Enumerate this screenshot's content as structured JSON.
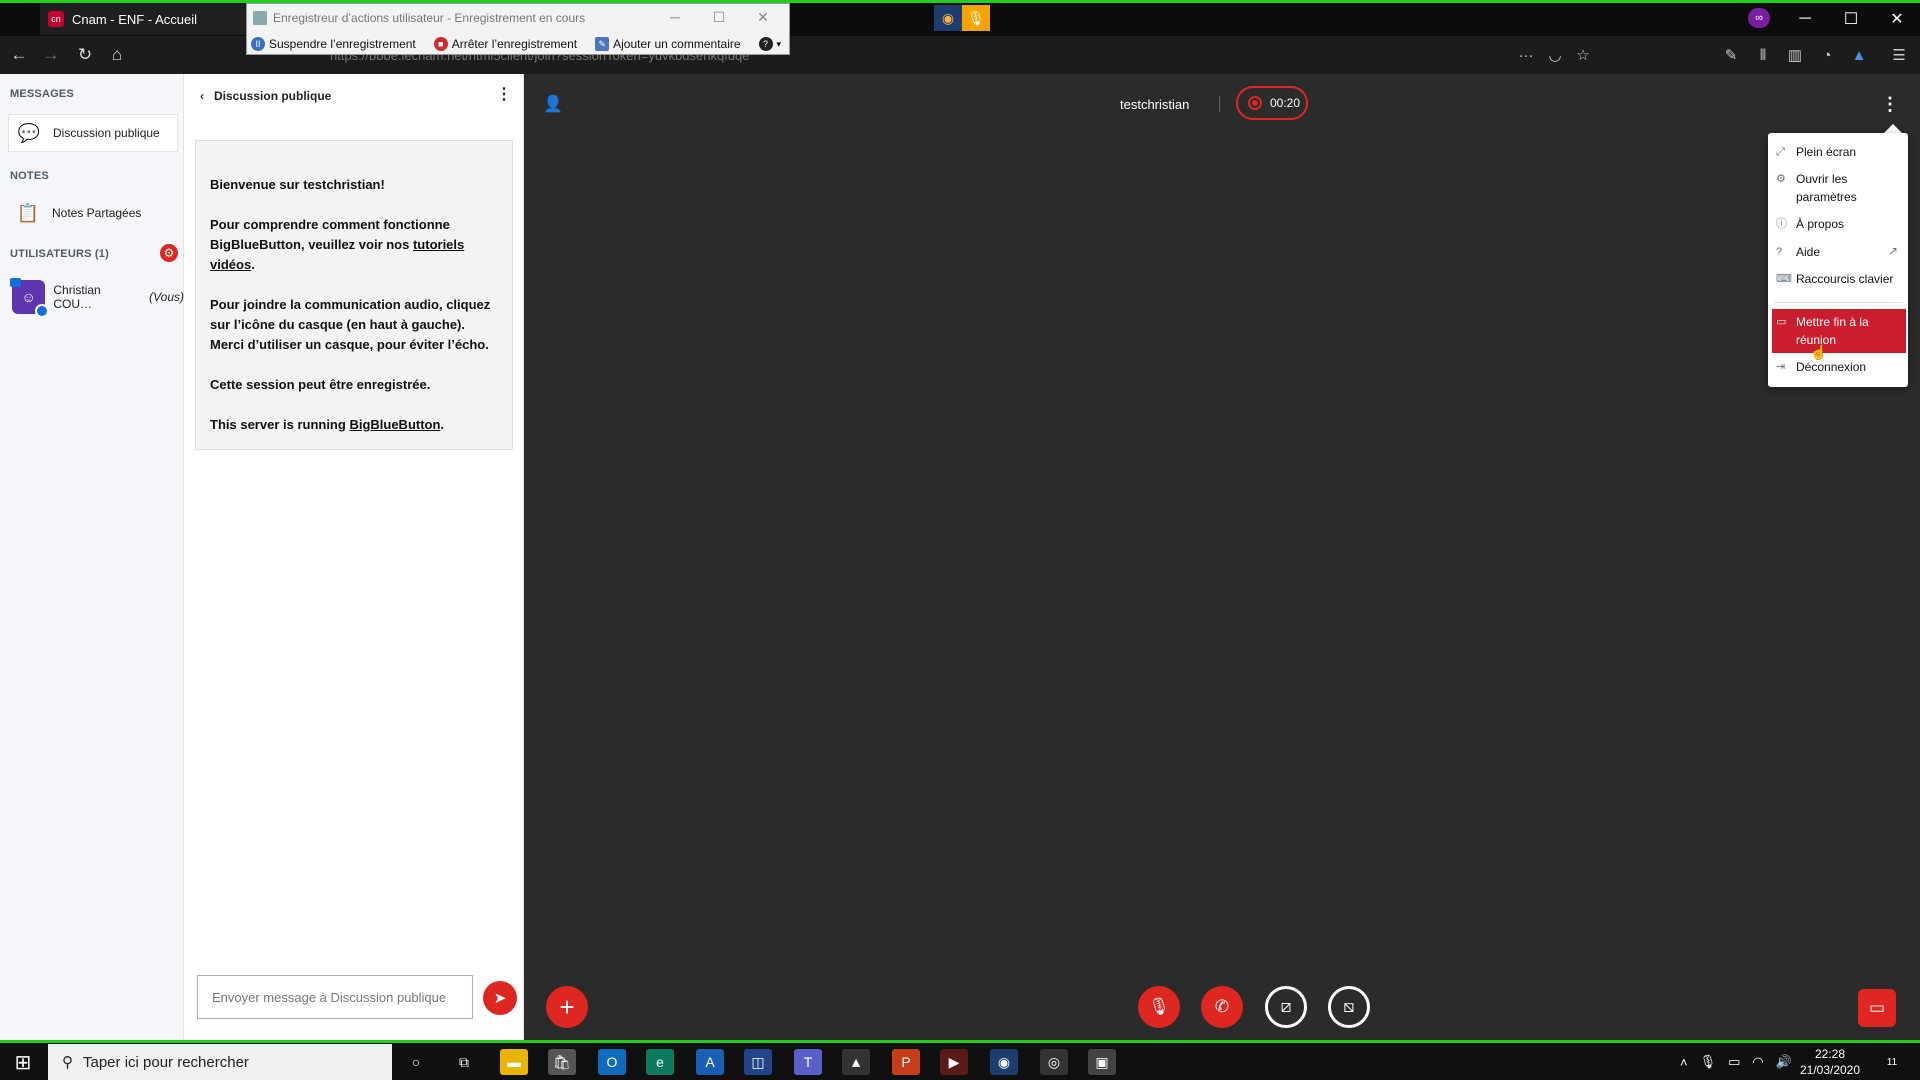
{
  "browser": {
    "tab_title": "Cnam - ENF - Accueil",
    "url": "https://bbbe.lecnam.net/html5client/join?sessionToken=yuvkbdsenkqfuqe"
  },
  "recorder": {
    "title": "Enregistreur d’actions utilisateur - Enregistrement en cours",
    "pause_label": "Suspendre l’enregistrement",
    "stop_label": "Arrêter l’enregistrement",
    "comment_label": "Ajouter un commentaire"
  },
  "sidebar": {
    "messages_heading": "MESSAGES",
    "public_chat_label": "Discussion publique",
    "notes_heading": "NOTES",
    "shared_notes_label": "Notes Partagées",
    "users_heading": "UTILISATEURS (1)",
    "user_name": "Christian COU…",
    "user_you": "(Vous)"
  },
  "chat": {
    "header": "Discussion publique",
    "welcome_title": "Bienvenue sur testchristian!",
    "welcome_p1_a": "Pour comprendre comment fonctionne BigBlueButton, veuillez voir nos ",
    "welcome_p1_link": "tutoriels vidéos",
    "welcome_p1_b": ".",
    "welcome_p2": "Pour joindre la communication audio, cliquez sur l’icône du casque (en haut à gauche). Merci d’utiliser un casque, pour éviter l’écho.",
    "welcome_p3": "Cette session peut être enregistrée.",
    "welcome_p4_a": "This server is running ",
    "welcome_p4_link": "BigBlueButton",
    "welcome_p4_b": ".",
    "input_placeholder": "Envoyer message à Discussion publique"
  },
  "meeting": {
    "name": "testchristian",
    "recording_time": "00:20"
  },
  "options_menu": {
    "fullscreen": "Plein écran",
    "settings": "Ouvrir les paramètres",
    "about": "À propos",
    "help": "Aide",
    "shortcuts": "Raccourcis clavier",
    "end_meeting": "Mettre fin à la réunion",
    "logout": "Déconnexion"
  },
  "taskbar": {
    "search_placeholder": "Taper ici pour rechercher",
    "time": "22:28",
    "date": "21/03/2020",
    "notif_count": "11"
  },
  "colors": {
    "accent_red": "#df2721",
    "end_meeting_bg": "#ca1d2e",
    "main_bg": "#2b2b2b",
    "green_frame": "#1fcf1f"
  }
}
